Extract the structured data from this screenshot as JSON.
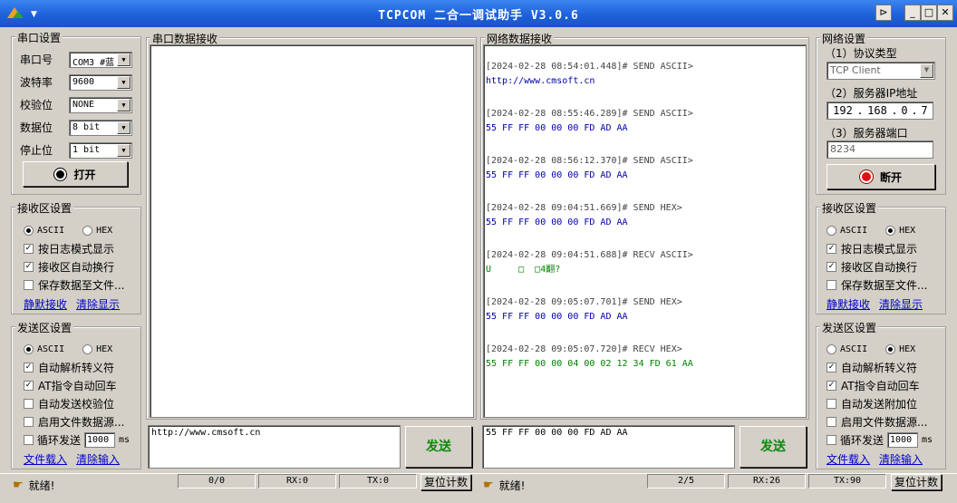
{
  "window": {
    "title": "TCPCOM 二合一调试助手  V3.0.6"
  },
  "serial": {
    "group_label": "串口设置",
    "fields": [
      {
        "label": "串口号",
        "value": "COM3 #蓝"
      },
      {
        "label": "波特率",
        "value": "9600"
      },
      {
        "label": "校验位",
        "value": "NONE"
      },
      {
        "label": "数据位",
        "value": "8 bit"
      },
      {
        "label": "停止位",
        "value": "1 bit"
      }
    ],
    "open_label": "打开"
  },
  "left_rx": {
    "group_label": "接收区设置",
    "radio": [
      {
        "label": "ASCII",
        "on": true
      },
      {
        "label": "HEX",
        "on": false
      }
    ],
    "checks": [
      {
        "label": "按日志模式显示",
        "checked": true
      },
      {
        "label": "接收区自动换行",
        "checked": true
      },
      {
        "label": "保存数据至文件...",
        "checked": false
      }
    ],
    "links": [
      "静默接收",
      "清除显示"
    ]
  },
  "left_tx": {
    "group_label": "发送区设置",
    "radio": [
      {
        "label": "ASCII",
        "on": true
      },
      {
        "label": "HEX",
        "on": false
      }
    ],
    "checks": [
      {
        "label": "自动解析转义符",
        "checked": true
      },
      {
        "label": "AT指令自动回车",
        "checked": true
      },
      {
        "label": "自动发送校验位",
        "checked": false
      },
      {
        "label": "启用文件数据源...",
        "checked": false
      }
    ],
    "loop_label": "循环发送",
    "loop_value": "1000",
    "loop_unit": "ms",
    "links": [
      "文件载入",
      "清除输入"
    ]
  },
  "serial_rx": {
    "group_label": "串口数据接收"
  },
  "net_rx": {
    "group_label": "网络数据接收",
    "entries": [
      {
        "header": "[2024-02-28 08:54:01.448]# SEND ASCII>",
        "body": "http://www.cmsoft.cn",
        "kind": "send"
      },
      {
        "header": "[2024-02-28 08:55:46.289]# SEND ASCII>",
        "body": "55 FF FF 00 00 00 FD AD AA",
        "kind": "send"
      },
      {
        "header": "[2024-02-28 08:56:12.370]# SEND ASCII>",
        "body": "55 FF FF 00 00 00 FD AD AA",
        "kind": "send"
      },
      {
        "header": "[2024-02-28 09:04:51.669]# SEND HEX>",
        "body": "55 FF FF 00 00 00 FD AD AA",
        "kind": "send"
      },
      {
        "header": "[2024-02-28 09:04:51.688]# RECV ASCII>",
        "body": "U     □  □4翻?",
        "kind": "recv"
      },
      {
        "header": "[2024-02-28 09:05:07.701]# SEND HEX>",
        "body": "55 FF FF 00 00 00 FD AD AA",
        "kind": "send"
      },
      {
        "header": "[2024-02-28 09:05:07.720]# RECV HEX>",
        "body": "55 FF FF 00 00 04 00 02 12 34 FD 61 AA",
        "kind": "recv"
      }
    ]
  },
  "serial_send": {
    "text": "http://www.cmsoft.cn",
    "button": "发送"
  },
  "net_send": {
    "text": "55 FF FF 00 00 00 FD AD AA",
    "button": "发送"
  },
  "network": {
    "group_label": "网络设置",
    "protocol_label": "（1）协议类型",
    "protocol_value": "TCP Client",
    "ip_label": "（2）服务器IP地址",
    "ip_parts": [
      "192",
      "168",
      "0",
      "7"
    ],
    "port_label": "（3）服务器端口",
    "port_value": "8234",
    "disconnect_label": "断开"
  },
  "right_rx": {
    "group_label": "接收区设置",
    "radio": [
      {
        "label": "ASCII",
        "on": false
      },
      {
        "label": "HEX",
        "on": true
      }
    ],
    "checks": [
      {
        "label": "按日志模式显示",
        "checked": true
      },
      {
        "label": "接收区自动换行",
        "checked": true
      },
      {
        "label": "保存数据至文件...",
        "checked": false
      }
    ],
    "links": [
      "静默接收",
      "清除显示"
    ]
  },
  "right_tx": {
    "group_label": "发送区设置",
    "radio": [
      {
        "label": "ASCII",
        "on": false
      },
      {
        "label": "HEX",
        "on": true
      }
    ],
    "checks": [
      {
        "label": "自动解析转义符",
        "checked": true
      },
      {
        "label": "AT指令自动回车",
        "checked": true
      },
      {
        "label": "自动发送附加位",
        "checked": false
      },
      {
        "label": "启用文件数据源...",
        "checked": false
      }
    ],
    "loop_label": "循环发送",
    "loop_value": "1000",
    "loop_unit": "ms",
    "links": [
      "文件载入",
      "清除输入"
    ]
  },
  "status_left": {
    "ready": "就绪!",
    "count": "0/0",
    "rx": "RX:0",
    "tx": "TX:0",
    "reset": "复位计数"
  },
  "status_right": {
    "ready": "就绪!",
    "count": "2/5",
    "rx": "RX:26",
    "tx": "TX:90",
    "reset": "复位计数"
  },
  "colors": {
    "title_bar": "#1c5fd8",
    "send_text": "#0000aa",
    "recv_text": "#008000",
    "header_text": "#444444",
    "send_button_text": "#0a8a0a"
  },
  "icons": {
    "app": "app-logo-icon",
    "pin": "pin-icon",
    "ready": "hand-pointer-icon"
  }
}
